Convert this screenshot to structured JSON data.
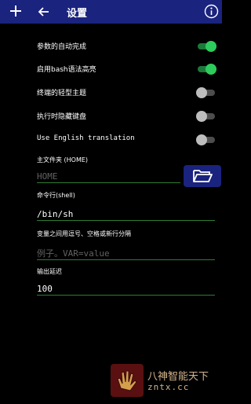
{
  "appbar": {
    "title": "设置",
    "plus_icon": "plus-icon",
    "back_icon": "arrow-back-icon",
    "info_icon": "info-icon",
    "background": "#1a237e"
  },
  "settings": [
    {
      "label": "参数的自动完成",
      "state": "on"
    },
    {
      "label": "启用bash语法高亮",
      "state": "on"
    },
    {
      "label": "终端的轻型主题",
      "state": "off"
    },
    {
      "label": "执行时隐藏键盘",
      "state": "off"
    },
    {
      "label": "Use English translation",
      "state": "off"
    }
  ],
  "home": {
    "label": "主文件夹 (HOME)",
    "value": "",
    "placeholder": "HOME",
    "folder_icon": "folder-open-icon"
  },
  "shell": {
    "label": "命令行(shell)",
    "value": "/bin/sh"
  },
  "env": {
    "label": "变量之间用逗号、空格或新行分隔",
    "value": "",
    "placeholder": "例子。VAR=value"
  },
  "output_delay": {
    "label": "输出延迟",
    "value": "100"
  },
  "watermark": {
    "title": "八神智能天下",
    "url": "zntx.cc"
  },
  "colors": {
    "switch_on": "#2ecc5c",
    "switch_off": "#bdbdbd",
    "field_underline": "#2e7d32"
  }
}
